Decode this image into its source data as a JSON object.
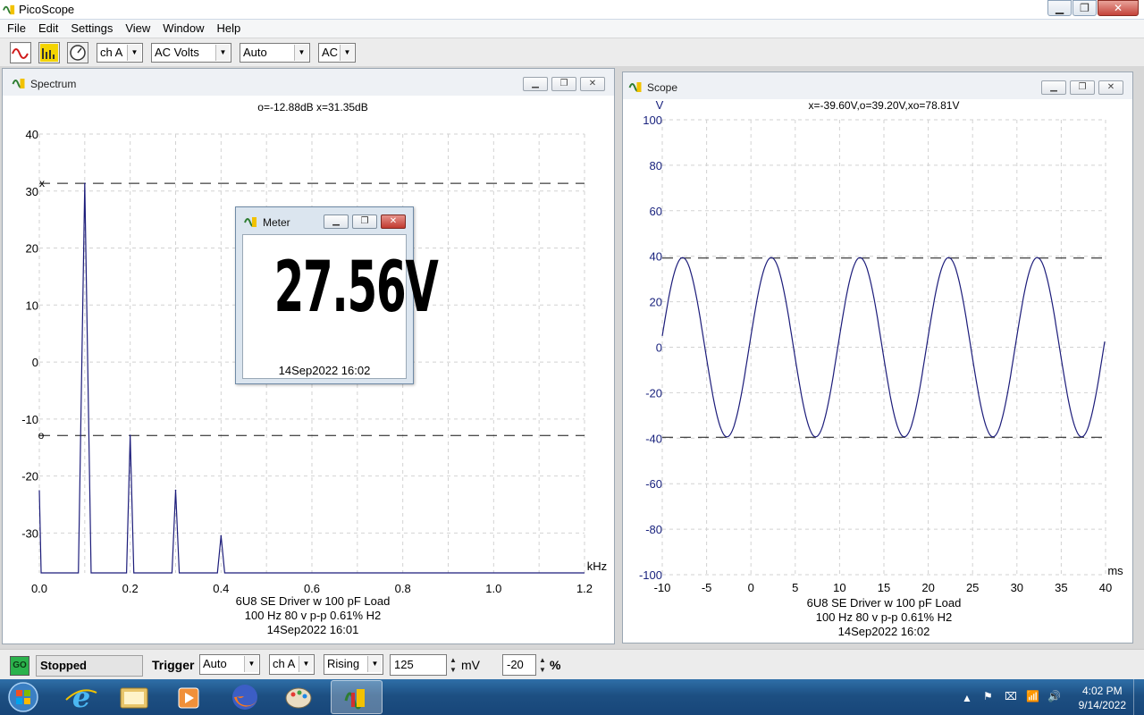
{
  "app": {
    "title": "PicoScope"
  },
  "menu": [
    "File",
    "Edit",
    "Settings",
    "View",
    "Window",
    "Help"
  ],
  "toolbar": {
    "channel": "ch A",
    "mode": "AC Volts",
    "range": "Auto",
    "coupling": "AC"
  },
  "spectrum": {
    "window_title": "Spectrum",
    "readout": "o=-12.88dB  x=31.35dB",
    "x_unit": "kHz",
    "x_ticks": [
      "0.0",
      "0.2",
      "0.4",
      "0.6",
      "0.8",
      "1.0",
      "1.2"
    ],
    "y_ticks": [
      "40",
      "30",
      "20",
      "10",
      "0",
      "-10",
      "-20",
      "-30"
    ],
    "cursor_x_label": "x",
    "cursor_o_label": "o",
    "caption": [
      "6U8 SE Driver w 100 pF Load",
      "100 Hz 80 v p-p 0.61% H2",
      "14Sep2022  16:01"
    ]
  },
  "scope": {
    "window_title": "Scope",
    "y_unit": "V",
    "readout": "x=-39.60V,o=39.20V,xo=78.81V",
    "x_unit": "ms",
    "x_ticks": [
      "-10",
      "-5",
      "0",
      "5",
      "10",
      "15",
      "20",
      "25",
      "30",
      "35",
      "40"
    ],
    "y_ticks": [
      "100",
      "80",
      "60",
      "40",
      "20",
      "0",
      "-20",
      "-40",
      "-60",
      "-80",
      "-100"
    ],
    "caption": [
      "6U8 SE Driver w 100 pF Load",
      "100 Hz 80 v p-p 0.61% H2",
      "14Sep2022  16:02"
    ]
  },
  "meter": {
    "window_title": "Meter",
    "value": "27.56V",
    "date": "14Sep2022  16:02"
  },
  "status": {
    "go_label": "GO",
    "state": "Stopped",
    "trigger_label": "Trigger",
    "trigger_mode": "Auto",
    "trigger_channel": "ch A",
    "trigger_edge": "Rising",
    "trigger_level": "125",
    "trigger_unit": "mV",
    "pretrigger": "-20",
    "pretrigger_unit": "%"
  },
  "clock": {
    "time": "4:02 PM",
    "date": "9/14/2022"
  },
  "chart_data": [
    {
      "type": "line",
      "x_unit": "kHz",
      "y_unit": "dB",
      "xlim": [
        0,
        1.2
      ],
      "ylim": [
        -37,
        40
      ],
      "cursors": {
        "x": 31.35,
        "o": -12.88
      },
      "grid": true,
      "series": [
        {
          "peaks_x": [
            0.1,
            0.2,
            0.3,
            0.4
          ],
          "peaks_y": [
            31.35,
            -12.88,
            -22.5,
            -30.5
          ]
        }
      ]
    },
    {
      "type": "line",
      "x_unit": "ms",
      "y_unit": "V",
      "xlim": [
        -10,
        40
      ],
      "ylim": [
        -100,
        100
      ],
      "cursors": {
        "x": -39.6,
        "o": 39.2
      },
      "grid": true,
      "series": [
        {
          "amplitude": 39.4,
          "frequency_hz": 100,
          "x_start": -10,
          "x_end": 40
        }
      ]
    }
  ]
}
